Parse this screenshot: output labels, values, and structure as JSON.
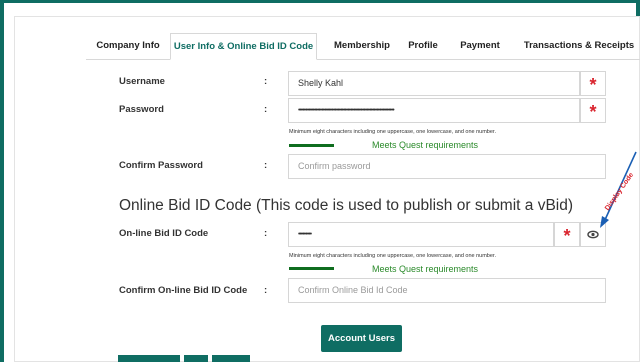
{
  "tabs": [
    {
      "label": "Company Info",
      "active": false
    },
    {
      "label": "User Info & Online Bid ID Code",
      "active": true
    },
    {
      "label": "Membership",
      "active": false
    },
    {
      "label": "Profile",
      "active": false
    },
    {
      "label": "Payment",
      "active": false
    },
    {
      "label": "Transactions & Receipts",
      "active": false
    }
  ],
  "form": {
    "colon": ":",
    "required_mark": "*",
    "username": {
      "label": "Username",
      "value": "Shelly Kahl"
    },
    "password": {
      "label": "Password",
      "value": "••••••••••••••••••••••••••••••••••••••••••••••••••••••••••••••••••",
      "hint": "Minimum eight characters including one uppercase, one lowercase, and one number.",
      "strength_text": "Meets Quest requirements"
    },
    "confirm_password": {
      "label": "Confirm Password",
      "placeholder": "Confirm password"
    }
  },
  "bid_section": {
    "title": "Online Bid ID Code (This code is used to publish or submit a vBid)",
    "bid_code": {
      "label": "On-line Bid ID Code",
      "value": "•••••••••",
      "hint": "Minimum eight characters including one uppercase, one lowercase, and one number.",
      "strength_text": "Meets Quest requirements"
    },
    "confirm_bid_code": {
      "label": "Confirm On-line Bid ID Code",
      "placeholder": "Confirm Online Bid Id Code"
    }
  },
  "annotation": {
    "text": "Display Code"
  },
  "buttons": {
    "account_users": "Account Users"
  },
  "colors": {
    "accent": "#0f6d63",
    "required": "#d9232d",
    "success": "#2a8a2a",
    "annotation_arrow": "#1a5fb4"
  },
  "icons": {
    "reveal": "eye-icon",
    "annotation": "arrow-icon"
  }
}
